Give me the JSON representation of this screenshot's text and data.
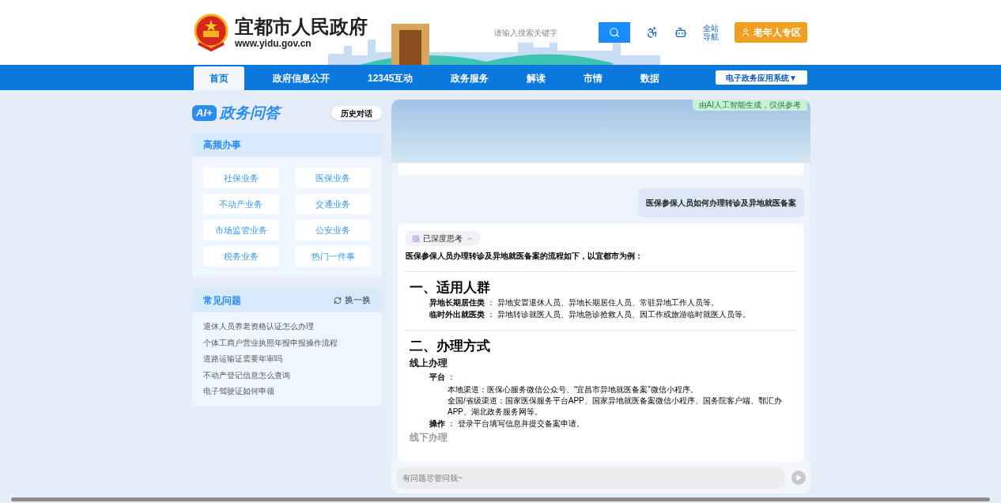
{
  "header": {
    "site_title": "宜都市人民政府",
    "site_url": "www.yidu.gov.cn",
    "search": {
      "placeholder": "请输入搜索关键字"
    },
    "site_nav_link": "全站导航",
    "elder_button": "老年人专区"
  },
  "nav": {
    "items": [
      {
        "label": "首页",
        "selected": true
      },
      {
        "label": "政府信息公开",
        "selected": false
      },
      {
        "label": "12345互动",
        "selected": false
      },
      {
        "label": "政务服务",
        "selected": false
      },
      {
        "label": "解读",
        "selected": false
      },
      {
        "label": "市情",
        "selected": false
      },
      {
        "label": "数据",
        "selected": false
      }
    ],
    "dropdown": "电子政务应用系统▼"
  },
  "assistant": {
    "logo_mark": "AI+",
    "title": "政务问答",
    "history_button": "历史对话"
  },
  "frequent": {
    "title": "高频办事",
    "items": [
      "社保业务",
      "医保业务",
      "不动产业务",
      "交通业务",
      "市场监管业务",
      "公安业务",
      "税务业务",
      "热门一件事"
    ]
  },
  "faq": {
    "title": "常见问题",
    "refresh": "换一换",
    "items": [
      "退休人员养老资格认证怎么办理",
      "个体工商户营业执照年报申报操作流程",
      "道路运输证需要年审吗",
      "不动产登记信息怎么查询",
      "电子驾驶证如何申领"
    ]
  },
  "chat": {
    "ai_notice": "由AI人工智能生成，仅供参考",
    "user_message": "医保参保人员如何办理转诊及异地就医备案",
    "thinking": {
      "label": "已深度思考",
      "expanded": true
    },
    "intro": "医保参保人员办理转诊及异地就医备案的流程如下，以宜都市为例：",
    "sections": [
      {
        "heading": "一、适用人群",
        "groups": [
          {
            "items": [
              {
                "text": "**异地长期居住类** ： 异地安置退休人员、异地长期居住人员、常驻异地工作人员等。"
              },
              {
                "text": "**临时外出就医类** ： 异地转诊就医人员、异地急诊抢救人员、因工作或旅游临时就医人员等。"
              }
            ]
          }
        ]
      },
      {
        "heading": "二、办理方式",
        "groups": [
          {
            "title": "线上办理",
            "items": [
              {
                "text": "**平台** ：",
                "children": [
                  "本地渠道：医保心服务微信公众号、“宜昌市异地就医备案”微信小程序。",
                  "全国/省级渠道：国家医保服务平台APP、国家异地就医备案微信小程序、国务院客户端、鄂汇办APP、湖北政务服务网等。"
                ]
              },
              {
                "text": "**操作** ： 登录平台填写信息并提交备案申请。"
              }
            ]
          },
          {
            "title": "线下办理"
          }
        ]
      }
    ]
  },
  "input": {
    "placeholder": "有问题尽管问我~"
  }
}
